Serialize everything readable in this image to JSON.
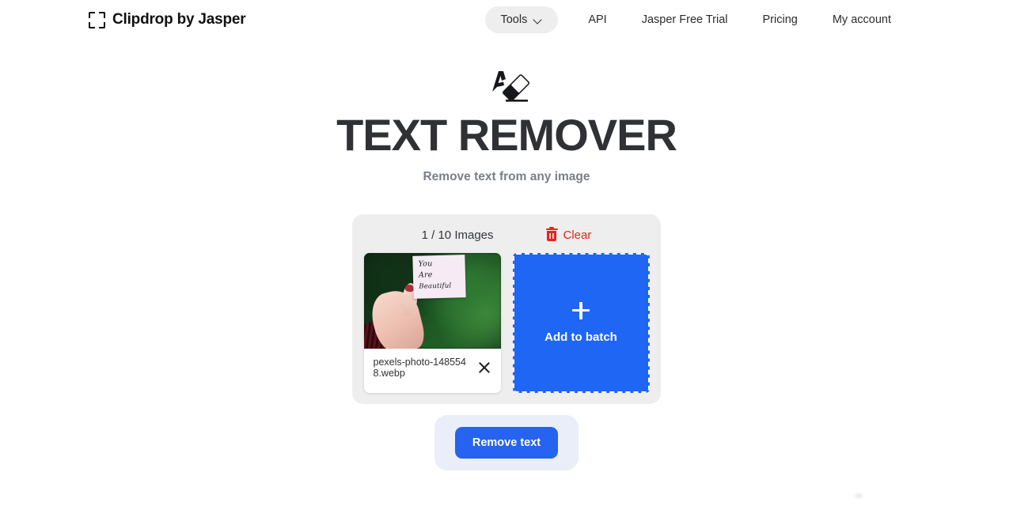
{
  "header": {
    "brand": {
      "name_bold": "Clipdrop",
      "name_rest": " by Jasper",
      "icon": "crop-frame-icon"
    },
    "nav": {
      "tools_label": "Tools",
      "tools_icon": "chevron-down-icon",
      "links": [
        "API",
        "Jasper Free Trial",
        "Pricing",
        "My account"
      ]
    }
  },
  "hero": {
    "icon": "text-eraser-icon",
    "title": "TEXT REMOVER",
    "subtitle": "Remove text from any image"
  },
  "uploader": {
    "count_label": "1 / 10 Images",
    "clear_label": "Clear",
    "clear_icon": "trash-icon",
    "clear_color": "#e5231b",
    "thumbnail": {
      "filename": "pexels-photo-1485548.webp",
      "remove_icon": "close-x-icon",
      "image_alt_lines": [
        "You",
        "Are",
        "Beautiful"
      ]
    },
    "add_tile": {
      "label": "Add to batch",
      "icon": "plus-icon",
      "color": "#1f66f5"
    }
  },
  "action": {
    "primary_label": "Remove text",
    "primary_color": "#2563f0",
    "shell_color": "#eaeef8"
  }
}
